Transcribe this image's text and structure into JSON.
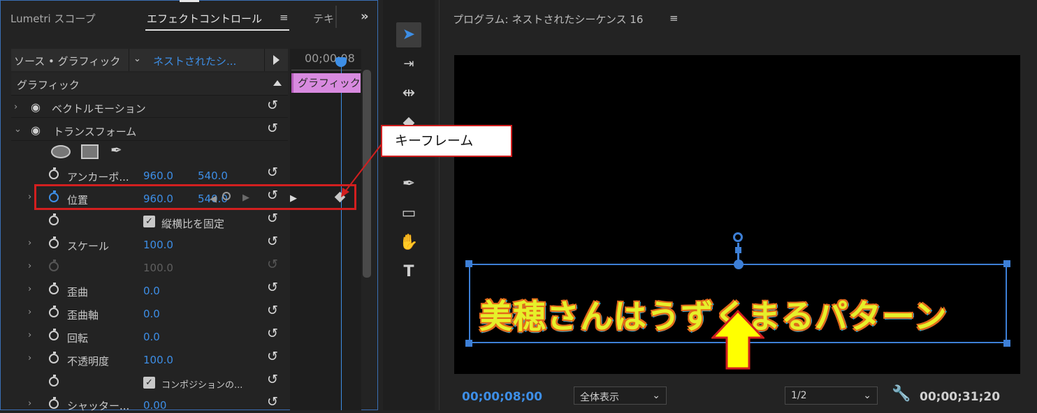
{
  "left_panel": {
    "tabs": [
      {
        "label": "Lumetri スコープ"
      },
      {
        "label": "エフェクトコントロール"
      },
      {
        "label": "テキ"
      }
    ],
    "source_label": "ソース • グラフィック",
    "sequence_clip": "ネストされたシ...",
    "timeline_timecode": "00;00;08",
    "clip_label": "グラフィック",
    "section_title": "グラフィック",
    "rows": [
      {
        "label": "ベクトルモーション"
      },
      {
        "label": "トランスフォーム"
      },
      {
        "label": "アンカーポ...",
        "v1": "960.0",
        "v2": "540.0"
      },
      {
        "label": "位置",
        "v1": "960.0",
        "v2": "540.0"
      },
      {
        "checkbox_label": "縦横比を固定"
      },
      {
        "label": "スケール",
        "v1": "100.0"
      },
      {
        "v1": "100.0"
      },
      {
        "label": "歪曲",
        "v1": "0.0"
      },
      {
        "label": "歪曲軸",
        "v1": "0.0"
      },
      {
        "label": "回転",
        "v1": "0.0"
      },
      {
        "label": "不透明度",
        "v1": "100.0"
      },
      {
        "checkbox_label": "コンポジションの..."
      },
      {
        "label": "シャッター...",
        "v1": "0.00"
      }
    ]
  },
  "callout": {
    "label": "キーフレーム"
  },
  "program": {
    "title": "プログラム: ネストされたシーケンス 16",
    "overlay_text": "美穂さんはうずくまるパターン",
    "current_timecode": "00;00;08;00",
    "zoom": "全体表示",
    "resolution": "1/2",
    "duration": "00;00;31;20"
  },
  "colors": {
    "accent": "#3d8ee6",
    "callout_red": "#d21f1f",
    "clip_pink": "#d88adf",
    "arrow_yellow": "#ffff00"
  }
}
